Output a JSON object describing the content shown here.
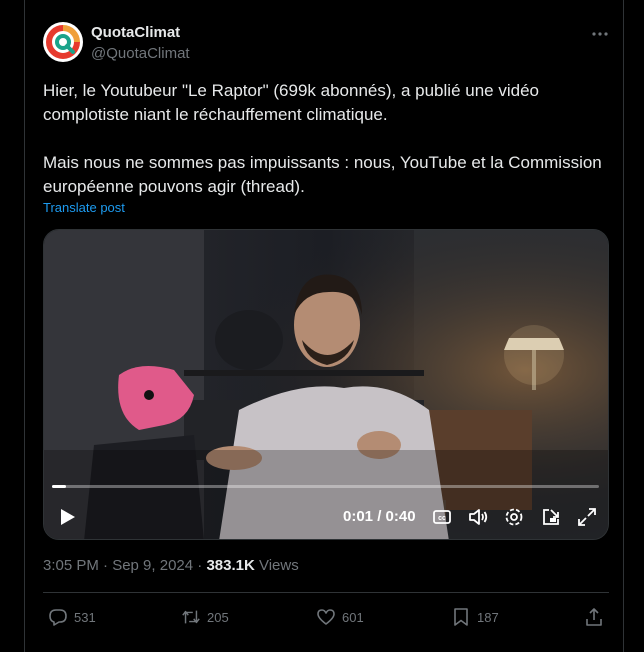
{
  "author": {
    "name": "QuotaClimat",
    "handle": "@QuotaClimat"
  },
  "tweet": {
    "paragraph1": "Hier, le Youtubeur \"Le Raptor\" (699k abonnés), a publié une vidéo complotiste niant le réchauffement climatique.",
    "paragraph2": "Mais nous ne sommes pas impuissants : nous, YouTube et la Commission européenne pouvons agir (thread).",
    "translate_label": "Translate post"
  },
  "video": {
    "time_display": "0:01 / 0:40",
    "progress_fraction": 0.025
  },
  "meta": {
    "timestamp": "3:05 PM · Sep 9, 2024 · ",
    "views_count": "383.1K",
    "views_label": " Views"
  },
  "actions": {
    "replies": "531",
    "reposts": "205",
    "likes": "601",
    "bookmarks": "187"
  },
  "colors": {
    "background": "#000000",
    "text": "#e7e9ea",
    "secondary": "#71767b",
    "link": "#1d9bf0",
    "logo_red": "#e63a2e",
    "logo_teal": "#1aa38a"
  },
  "icons": [
    "more-icon",
    "play-icon",
    "captions-icon",
    "volume-icon",
    "settings-icon",
    "pip-icon",
    "fullscreen-icon",
    "reply-icon",
    "repost-icon",
    "like-icon",
    "bookmark-icon",
    "share-icon"
  ]
}
